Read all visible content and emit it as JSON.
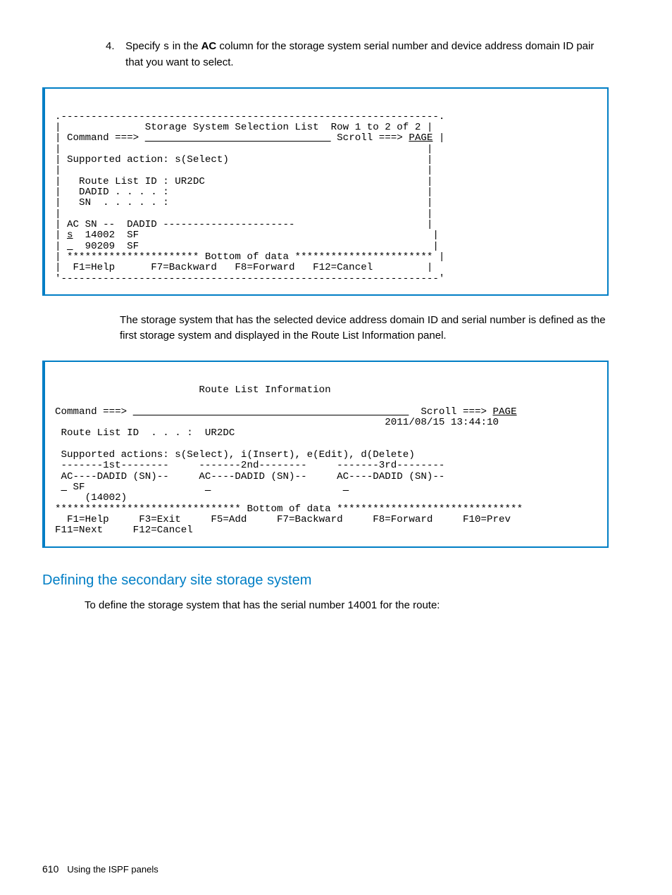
{
  "step": {
    "number": "4.",
    "prefix": "Specify ",
    "code": "s",
    "middle1": " in the ",
    "bold": "AC",
    "suffix": " column for the storage system serial number and device address domain ID pair that you want to select."
  },
  "terminal1": {
    "l01": ".---------------------------------------------------------------.",
    "l02": "|              Storage System Selection List  Row 1 to 2 of 2 |",
    "l03a": "| Command ===> ",
    "l03u": "                               ",
    "l03b": " Scroll ===> ",
    "l03p": "PAGE",
    "l03e": " |",
    "l04": "|                                                             |",
    "l05": "| Supported action: s(Select)                                 |",
    "l06": "|                                                             |",
    "l07": "|   Route List ID : UR2DC                                     |",
    "l08": "|   DADID . . . . :                                           |",
    "l09": "|   SN  . . . . . :                                           |",
    "l10": "|                                                             |",
    "l11": "| AC SN --  DADID ----------------------                      |",
    "l12a": "| ",
    "l12u": "s",
    "l12b": "  14002  SF                                                 |",
    "l13a": "| ",
    "l13u": " ",
    "l13b": "  90209  SF                                                 |",
    "l14": "| ********************** Bottom of data *********************** |",
    "l15": "|  F1=Help      F7=Backward   F8=Forward   F12=Cancel         |",
    "l16": "'---------------------------------------------------------------'"
  },
  "desc1": "The storage system that has the selected device address domain ID and serial number is defined as the first storage system and displayed in the Route List Information panel.",
  "terminal2": {
    "l01": "                        Route List Information                            ",
    "l02": "",
    "l03a": "Command ===> ",
    "l03u": "                                              ",
    "l03b": "  Scroll ===> ",
    "l03p": "PAGE",
    "l04": "                                                       2011/08/15 13:44:10",
    "l05": " Route List ID  . . . :  UR2DC",
    "l06": "",
    "l07": " Supported actions: s(Select), i(Insert), e(Edit), d(Delete)",
    "l08": " -------1st--------     -------2nd--------     -------3rd--------",
    "l09": " AC----DADID (SN)--     AC----DADID (SN)--     AC----DADID (SN)--",
    "l10a": " ",
    "l10u": " ",
    "l10b": " SF                    ",
    "l10u2": " ",
    "l10c": "                      ",
    "l10u3": " ",
    "l11": "     (14002)",
    "l12": "******************************* Bottom of data *******************************",
    "l13": "  F1=Help     F3=Exit     F5=Add     F7=Backward     F8=Forward     F10=Prev",
    "l14": "F11=Next     F12=Cancel"
  },
  "heading": "Defining the secondary site storage system",
  "sectiontext": "To define the storage system that has the serial number 14001 for the route:",
  "footer": {
    "pagenum": "610",
    "text": "Using the ISPF panels"
  }
}
